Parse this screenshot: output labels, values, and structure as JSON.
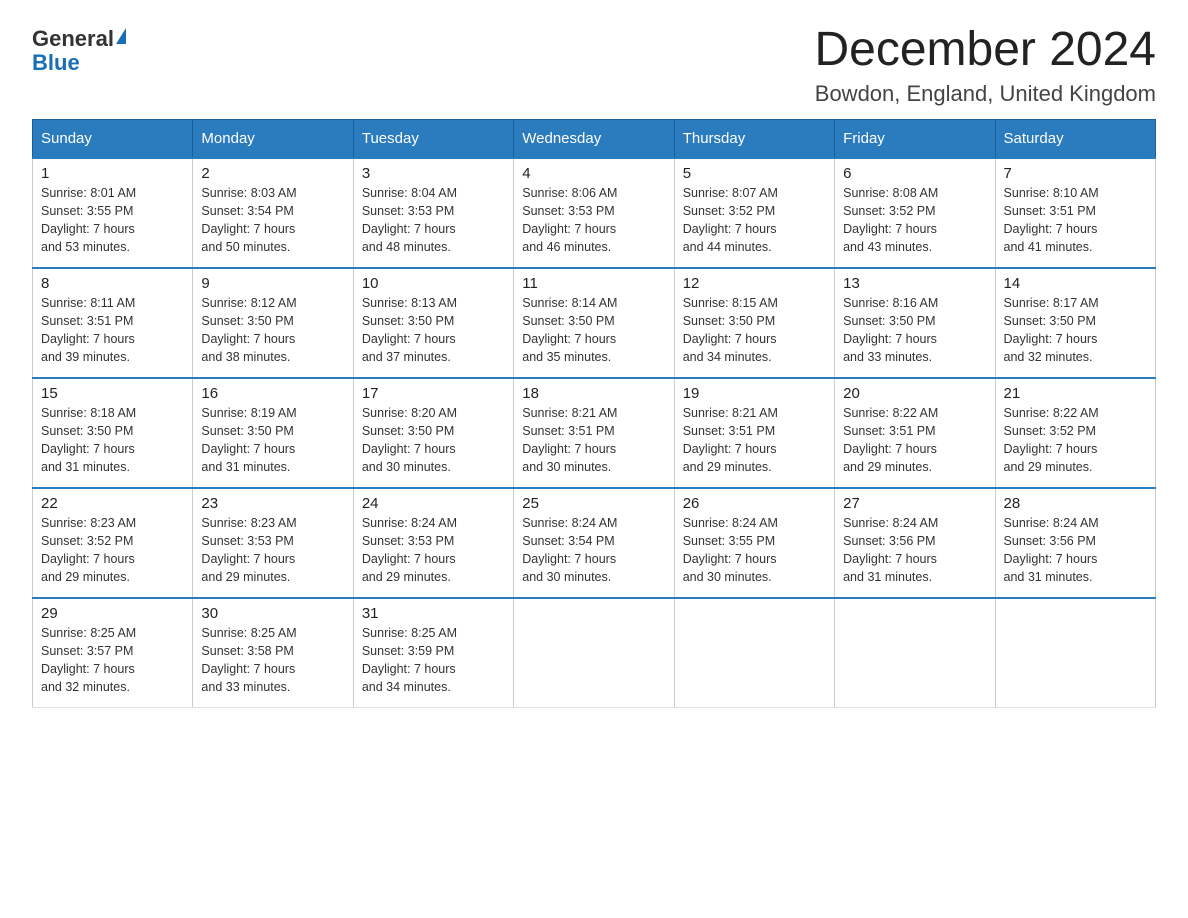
{
  "logo": {
    "general": "General",
    "blue": "Blue"
  },
  "title": "December 2024",
  "location": "Bowdon, England, United Kingdom",
  "headers": [
    "Sunday",
    "Monday",
    "Tuesday",
    "Wednesday",
    "Thursday",
    "Friday",
    "Saturday"
  ],
  "weeks": [
    [
      {
        "day": "1",
        "sunrise": "8:01 AM",
        "sunset": "3:55 PM",
        "daylight": "7 hours and 53 minutes."
      },
      {
        "day": "2",
        "sunrise": "8:03 AM",
        "sunset": "3:54 PM",
        "daylight": "7 hours and 50 minutes."
      },
      {
        "day": "3",
        "sunrise": "8:04 AM",
        "sunset": "3:53 PM",
        "daylight": "7 hours and 48 minutes."
      },
      {
        "day": "4",
        "sunrise": "8:06 AM",
        "sunset": "3:53 PM",
        "daylight": "7 hours and 46 minutes."
      },
      {
        "day": "5",
        "sunrise": "8:07 AM",
        "sunset": "3:52 PM",
        "daylight": "7 hours and 44 minutes."
      },
      {
        "day": "6",
        "sunrise": "8:08 AM",
        "sunset": "3:52 PM",
        "daylight": "7 hours and 43 minutes."
      },
      {
        "day": "7",
        "sunrise": "8:10 AM",
        "sunset": "3:51 PM",
        "daylight": "7 hours and 41 minutes."
      }
    ],
    [
      {
        "day": "8",
        "sunrise": "8:11 AM",
        "sunset": "3:51 PM",
        "daylight": "7 hours and 39 minutes."
      },
      {
        "day": "9",
        "sunrise": "8:12 AM",
        "sunset": "3:50 PM",
        "daylight": "7 hours and 38 minutes."
      },
      {
        "day": "10",
        "sunrise": "8:13 AM",
        "sunset": "3:50 PM",
        "daylight": "7 hours and 37 minutes."
      },
      {
        "day": "11",
        "sunrise": "8:14 AM",
        "sunset": "3:50 PM",
        "daylight": "7 hours and 35 minutes."
      },
      {
        "day": "12",
        "sunrise": "8:15 AM",
        "sunset": "3:50 PM",
        "daylight": "7 hours and 34 minutes."
      },
      {
        "day": "13",
        "sunrise": "8:16 AM",
        "sunset": "3:50 PM",
        "daylight": "7 hours and 33 minutes."
      },
      {
        "day": "14",
        "sunrise": "8:17 AM",
        "sunset": "3:50 PM",
        "daylight": "7 hours and 32 minutes."
      }
    ],
    [
      {
        "day": "15",
        "sunrise": "8:18 AM",
        "sunset": "3:50 PM",
        "daylight": "7 hours and 31 minutes."
      },
      {
        "day": "16",
        "sunrise": "8:19 AM",
        "sunset": "3:50 PM",
        "daylight": "7 hours and 31 minutes."
      },
      {
        "day": "17",
        "sunrise": "8:20 AM",
        "sunset": "3:50 PM",
        "daylight": "7 hours and 30 minutes."
      },
      {
        "day": "18",
        "sunrise": "8:21 AM",
        "sunset": "3:51 PM",
        "daylight": "7 hours and 30 minutes."
      },
      {
        "day": "19",
        "sunrise": "8:21 AM",
        "sunset": "3:51 PM",
        "daylight": "7 hours and 29 minutes."
      },
      {
        "day": "20",
        "sunrise": "8:22 AM",
        "sunset": "3:51 PM",
        "daylight": "7 hours and 29 minutes."
      },
      {
        "day": "21",
        "sunrise": "8:22 AM",
        "sunset": "3:52 PM",
        "daylight": "7 hours and 29 minutes."
      }
    ],
    [
      {
        "day": "22",
        "sunrise": "8:23 AM",
        "sunset": "3:52 PM",
        "daylight": "7 hours and 29 minutes."
      },
      {
        "day": "23",
        "sunrise": "8:23 AM",
        "sunset": "3:53 PM",
        "daylight": "7 hours and 29 minutes."
      },
      {
        "day": "24",
        "sunrise": "8:24 AM",
        "sunset": "3:53 PM",
        "daylight": "7 hours and 29 minutes."
      },
      {
        "day": "25",
        "sunrise": "8:24 AM",
        "sunset": "3:54 PM",
        "daylight": "7 hours and 30 minutes."
      },
      {
        "day": "26",
        "sunrise": "8:24 AM",
        "sunset": "3:55 PM",
        "daylight": "7 hours and 30 minutes."
      },
      {
        "day": "27",
        "sunrise": "8:24 AM",
        "sunset": "3:56 PM",
        "daylight": "7 hours and 31 minutes."
      },
      {
        "day": "28",
        "sunrise": "8:24 AM",
        "sunset": "3:56 PM",
        "daylight": "7 hours and 31 minutes."
      }
    ],
    [
      {
        "day": "29",
        "sunrise": "8:25 AM",
        "sunset": "3:57 PM",
        "daylight": "7 hours and 32 minutes."
      },
      {
        "day": "30",
        "sunrise": "8:25 AM",
        "sunset": "3:58 PM",
        "daylight": "7 hours and 33 minutes."
      },
      {
        "day": "31",
        "sunrise": "8:25 AM",
        "sunset": "3:59 PM",
        "daylight": "7 hours and 34 minutes."
      },
      null,
      null,
      null,
      null
    ]
  ]
}
